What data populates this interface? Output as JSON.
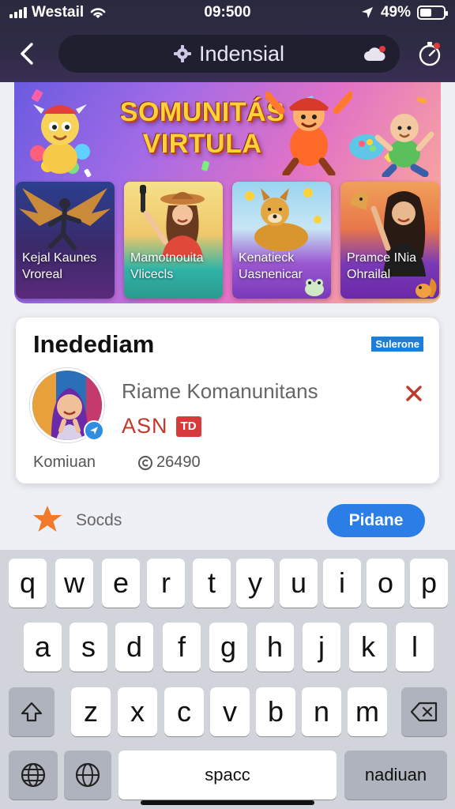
{
  "status_bar": {
    "carrier": "Westail",
    "time": "09:500",
    "battery": "49%"
  },
  "header": {
    "title": "Indensial"
  },
  "banner": {
    "title_line1": "SOMUNITÁS",
    "title_line2": "VIRTULA",
    "cards": [
      {
        "line1": "Kejal Kaunes",
        "line2": "Vroreal"
      },
      {
        "line1": "Mamotnouita",
        "line2": "Vlicecls"
      },
      {
        "line1": "Kenatieck",
        "line2": "Uasnenicar"
      },
      {
        "line1": "Pramce INia",
        "line2": "Ohrailal"
      }
    ]
  },
  "profile_card": {
    "heading": "Inedediam",
    "tag": "Sulerone",
    "name": "Riame Komanunitans",
    "code": "ASN",
    "badge": "TD",
    "footer_left": "Komiuan",
    "footer_right": "26490"
  },
  "action_row": {
    "label": "Socds",
    "button": "Pidane"
  },
  "keyboard": {
    "row1": [
      "q",
      "w",
      "e",
      "r",
      "t",
      "y",
      "u",
      "i",
      "o",
      "p"
    ],
    "row2": [
      "a",
      "s",
      "d",
      "f",
      "g",
      "h",
      "j",
      "k",
      "l"
    ],
    "row3": [
      "z",
      "x",
      "c",
      "v",
      "b",
      "n",
      "m"
    ],
    "space": "spacc",
    "return": "nadiuan"
  },
  "colors": {
    "accent": "#2a7ee6",
    "header_bg": "#2f2b45",
    "close": "#c0392b"
  }
}
